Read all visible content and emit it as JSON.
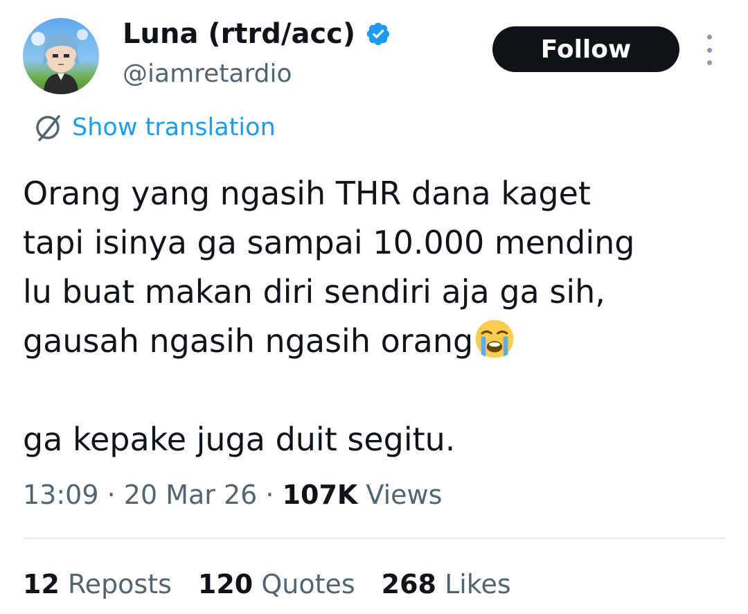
{
  "author": {
    "display_name": "Luna (rtrd/acc)",
    "handle": "@iamretardio",
    "verified_icon": "verified-badge-icon",
    "avatar_icon": "avatar"
  },
  "actions": {
    "follow_label": "Follow",
    "more_icon": "more-vertical-icon"
  },
  "translation": {
    "icon": "globe-icon",
    "label": "Show translation"
  },
  "tweet": {
    "text": "Orang yang ngasih THR dana kaget\ntapi isinya ga sampai 10.000 mending\nlu buat makan diri sendiri aja ga sih,\ngausah ngasih ngasih orang",
    "emoji": "loudly-crying-face-icon",
    "text_after": "\n\nga kepake juga duit segitu."
  },
  "meta": {
    "time": "13:09",
    "separator": " · ",
    "date": "20 Mar 26",
    "views_count": "107K",
    "views_label": " Views"
  },
  "stats": {
    "reposts_count": "12",
    "reposts_label": " Reposts",
    "quotes_count": "120",
    "quotes_label": " Quotes",
    "likes_count": "268",
    "likes_label": " Likes"
  },
  "colors": {
    "text": "#0f1419",
    "muted": "#536471",
    "link": "#1d9bf0",
    "verified": "#1d9bf0",
    "follow_bg": "#0f1419"
  }
}
